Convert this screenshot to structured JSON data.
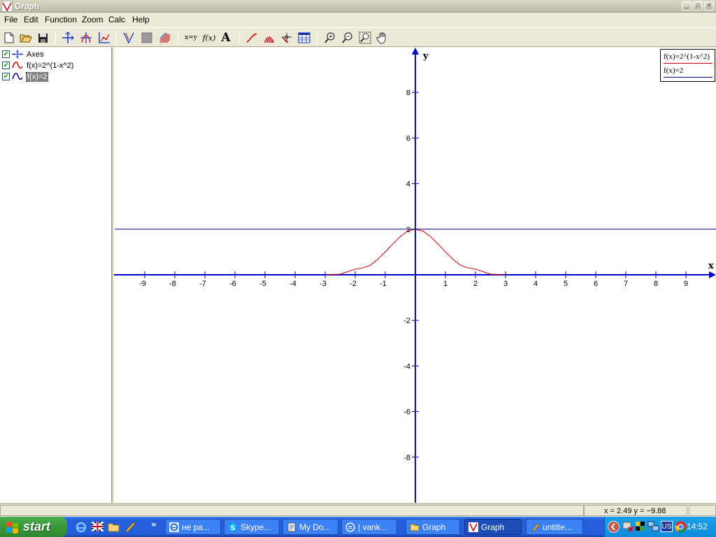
{
  "window": {
    "title": "Graph"
  },
  "menu": [
    "File",
    "Edit",
    "Function",
    "Zoom",
    "Calc",
    "Help"
  ],
  "toolbar": {
    "icons": [
      "new-file-icon",
      "open-folder-icon",
      "save-icon",
      "axes-icon",
      "add-function-icon",
      "add-point-series-icon",
      "tangent-icon",
      "shading-icon",
      "relation-icon",
      "xy-text-icon",
      "fx-text-icon",
      "font-icon",
      "trendline-icon",
      "integral-area-icon",
      "evaluate-icon",
      "table-icon",
      "zoom-in-icon",
      "zoom-out-icon",
      "zoom-window-icon",
      "pan-hand-icon"
    ],
    "xy_label": "x=y",
    "fx_label": "f(x)",
    "font_label": "A"
  },
  "function_list": [
    {
      "label": "Axes",
      "checked": true
    },
    {
      "label": "f(x)=2^(1-x^2)",
      "checked": true,
      "color": "#cc0000"
    },
    {
      "label": "f(x)=2",
      "checked": true,
      "color": "#000080",
      "selected": true
    }
  ],
  "plot": {
    "xlabel": "x",
    "ylabel": "y",
    "xlim": [
      -10,
      10
    ],
    "ylim": [
      -10,
      10
    ],
    "x_ticks": [
      "-9",
      "-8",
      "-7",
      "-6",
      "-5",
      "-4",
      "-3",
      "-2",
      "-1",
      "1",
      "2",
      "3",
      "4",
      "5",
      "6",
      "7",
      "8",
      "9"
    ],
    "y_ticks": [
      "8",
      "6",
      "4",
      "2",
      "-2",
      "-4",
      "-6",
      "-8"
    ],
    "axis_color": "#0000cc"
  },
  "chart_data": {
    "type": "line",
    "title": "",
    "xlabel": "x",
    "ylabel": "y",
    "xlim": [
      -10,
      10
    ],
    "ylim": [
      -10,
      10
    ],
    "series": [
      {
        "name": "f(x)=2^(1-x^2)",
        "color": "#cc0000",
        "x": [
          -3,
          -2.5,
          -2,
          -1.75,
          -1.5,
          -1.25,
          -1,
          -0.75,
          -0.5,
          -0.25,
          0,
          0.25,
          0.5,
          0.75,
          1,
          1.25,
          1.5,
          1.75,
          2,
          2.5,
          3
        ],
        "y": [
          0.004,
          0.027,
          0.25,
          0.3,
          0.42,
          0.68,
          1.0,
          1.36,
          1.68,
          1.92,
          2.0,
          1.92,
          1.68,
          1.36,
          1.0,
          0.68,
          0.42,
          0.3,
          0.25,
          0.027,
          0.004
        ]
      },
      {
        "name": "f(x)=2",
        "color": "#000080",
        "x": [
          -10,
          10
        ],
        "y": [
          2,
          2
        ]
      }
    ]
  },
  "legend": [
    {
      "label": "f(x)=2^(1-x^2)",
      "color": "#cc0000"
    },
    {
      "label": "f(x)=2",
      "color": "#000080"
    }
  ],
  "status": {
    "coords": "x = 2.49    y = −9.88"
  },
  "taskbar": {
    "start_label": "start",
    "tasks": [
      {
        "label": "не ра...",
        "icon": "internet-explorer-icon",
        "active": false
      },
      {
        "label": "Skype...",
        "icon": "skype-icon",
        "active": false
      },
      {
        "label": "My Do...",
        "icon": "word-document-icon",
        "active": false
      },
      {
        "label": "| vank...",
        "icon": "chat-icon",
        "active": false
      },
      {
        "label": "Graph",
        "icon": "folder-icon",
        "active": false
      },
      {
        "label": "Graph",
        "icon": "graph-app-icon",
        "active": true
      },
      {
        "label": "untitle...",
        "icon": "paint-icon",
        "active": false
      }
    ],
    "tray_lang": "US",
    "clock": "14:52"
  }
}
